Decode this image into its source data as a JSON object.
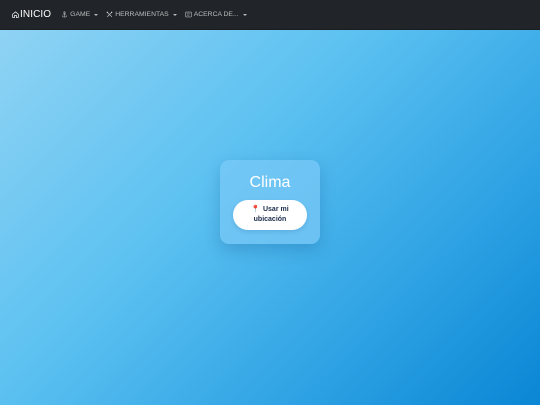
{
  "nav": {
    "brand": "INICIO",
    "items": [
      {
        "label": "GAME",
        "icon": "anchor-icon"
      },
      {
        "label": "HERRAMIENTAS",
        "icon": "tools-icon"
      },
      {
        "label": "ACERCA DE...",
        "icon": "info-box-icon"
      }
    ]
  },
  "weather": {
    "title": "Clima",
    "location_button_line1": "Usar mi",
    "location_button_line2": "ubicación",
    "location_icon": "map-pin-icon"
  },
  "colors": {
    "navbar": "#212529",
    "gradient_start": "#8fd3f4",
    "gradient_end": "#0a86d4",
    "pin": "#e5322e",
    "button_text": "#1a2b4a"
  }
}
